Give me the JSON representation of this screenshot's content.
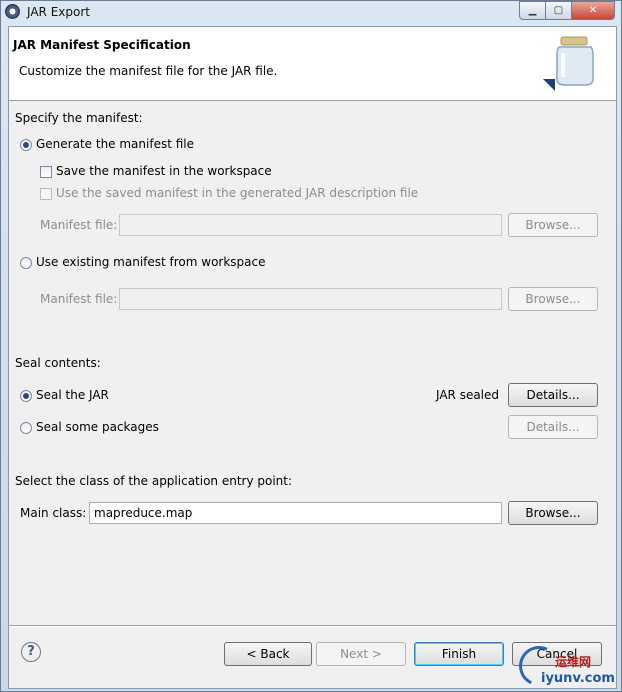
{
  "window": {
    "title": "JAR Export",
    "controls": {
      "minimize": "▁",
      "maximize": "▢",
      "close": "✕"
    }
  },
  "header": {
    "title": "JAR Manifest Specification",
    "description": "Customize the manifest file for the JAR file.",
    "icon": "jar-icon"
  },
  "manifest": {
    "section_label": "Specify the manifest:",
    "generate_option": {
      "label": "Generate the manifest file",
      "selected": true
    },
    "save_in_workspace": {
      "label": "Save the manifest in the workspace",
      "checked": false
    },
    "use_saved": {
      "label": "Use the saved manifest in the generated JAR description file",
      "checked": false,
      "enabled": false
    },
    "generated_file_label": "Manifest file:",
    "generated_file_value": "",
    "generated_browse": "Browse...",
    "existing_option": {
      "label": "Use existing manifest from workspace",
      "selected": false
    },
    "existing_file_label": "Manifest file:",
    "existing_file_value": "",
    "existing_browse": "Browse..."
  },
  "seal": {
    "section_label": "Seal contents:",
    "seal_jar": {
      "label": "Seal the JAR",
      "selected": true
    },
    "jar_sealed_status": "JAR sealed",
    "jar_details": "Details...",
    "seal_packages": {
      "label": "Seal some packages",
      "selected": false
    },
    "packages_details": "Details..."
  },
  "entry_point": {
    "section_label": "Select the class of the application entry point:",
    "main_class_label": "Main class:",
    "main_class_value": "mapreduce.map",
    "browse": "Browse..."
  },
  "footer": {
    "help": "?",
    "back": "< Back",
    "next": "Next >",
    "finish": "Finish",
    "cancel": "Cancel"
  },
  "watermark": {
    "line1": "运维网",
    "line2": "iyunv.com"
  }
}
